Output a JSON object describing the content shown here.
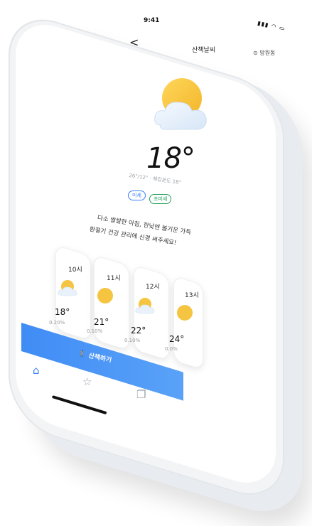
{
  "status": {
    "time": "9:41",
    "icons": "▮▮▮ ◥ ▭"
  },
  "header": {
    "title": "산책날씨",
    "location": "망원동",
    "back_glyph": "<"
  },
  "current": {
    "temperature": "18°",
    "detail": "26°/12° · 체감온도 18°",
    "badges": [
      "미세",
      "초미세"
    ],
    "message_line1": "다소 쌀쌀한 아침, 한낮엔 봄기운 가득",
    "message_line2": "환절기 건강 관리에 신경 써주세요!"
  },
  "hourly": [
    {
      "hour": "10시",
      "icon": "partly-cloudy",
      "temp": "18°",
      "prob": "0.20%"
    },
    {
      "hour": "11시",
      "icon": "sunny",
      "temp": "21°",
      "prob": "0.10%"
    },
    {
      "hour": "12시",
      "icon": "partly-cloudy",
      "temp": "22°",
      "prob": "0.10%"
    },
    {
      "hour": "13시",
      "icon": "sunny",
      "temp": "24°",
      "prob": "0.0%"
    }
  ],
  "cta": {
    "label": "산책하기"
  },
  "nav": {
    "items": [
      "home",
      "bookmark",
      "records"
    ]
  },
  "colors": {
    "accent": "#3b82f6",
    "sun": "#f5c542",
    "cloud": "#e6f0fb"
  }
}
